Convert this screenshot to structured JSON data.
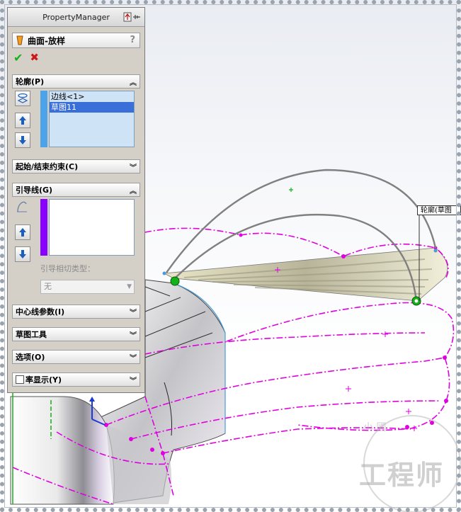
{
  "panel": {
    "title": "PropertyManager",
    "feature_name": "曲面-放样",
    "help": "?",
    "ok_glyph": "✔",
    "cancel_glyph": "✖"
  },
  "profiles": {
    "header": "轮廓(P)",
    "items": [
      "边线<1>",
      "草图11"
    ],
    "selected_index": 1
  },
  "start_end": {
    "header": "起始/结束约束(C)"
  },
  "guides": {
    "header": "引导线(G)",
    "tangency_label": "引导相切类型：",
    "tangency_value": "无"
  },
  "sections": {
    "centerline": "中心线参数(I)",
    "sketch_tools": "草图工具",
    "options": "选项(O)",
    "preview": "率显示(Y)"
  },
  "viewport": {
    "callout": "轮廓(草图",
    "watermark_big": "工程师",
    "watermark_small": "小  國"
  },
  "colors": {
    "accent_green": "#13b21a",
    "cancel_red": "#d01818",
    "guide_gray": "#808080",
    "sketch_magenta": "#e000e0",
    "profile_bar_blue": "#4da3ea",
    "guide_bar_purple": "#8a00ff",
    "selection": "#3a6ed8"
  }
}
